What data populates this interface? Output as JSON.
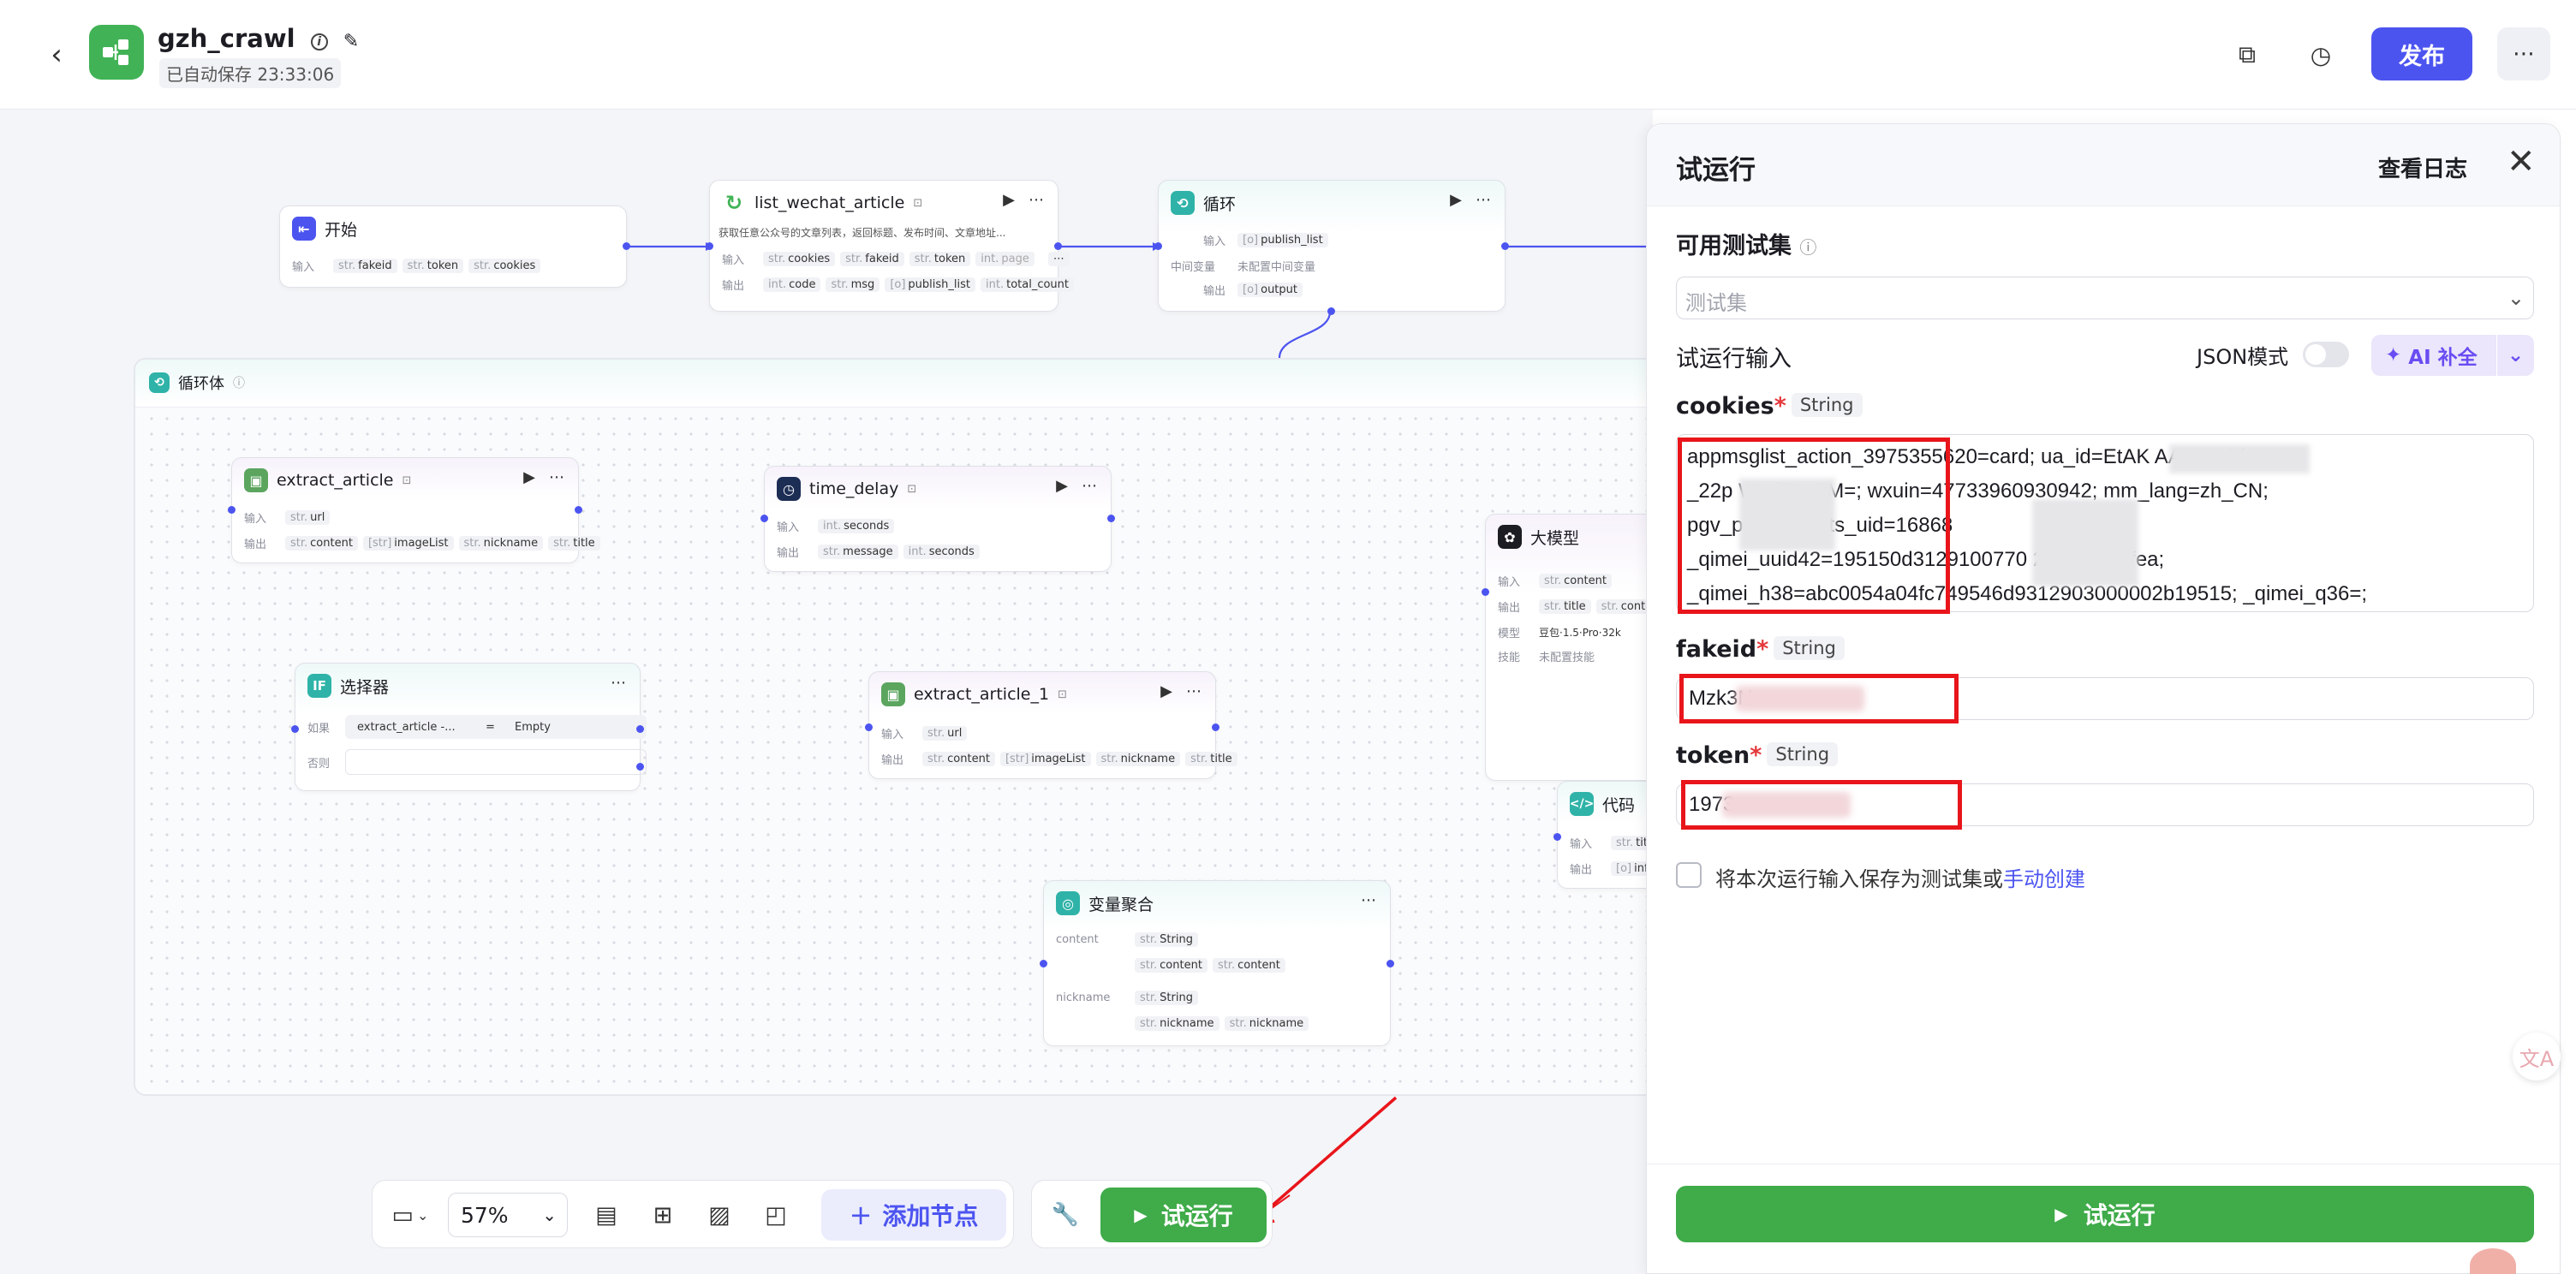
{
  "app": {
    "title": "gzh_crawl",
    "saved_status": "已自动保存 23:33:06",
    "publish_label": "发布"
  },
  "nodes": {
    "start": {
      "title": "开始",
      "input_label": "输入",
      "inputs": [
        "fakeid",
        "token",
        "cookies"
      ]
    },
    "list_wechat": {
      "title": "list_wechat_article",
      "desc": "获取任意公众号的文章列表，返回标题、发布时间、文章地址...",
      "input_label": "输入",
      "inputs": [
        "cookies",
        "fakeid",
        "token",
        "page"
      ],
      "output_label": "输出",
      "outputs": [
        "code",
        "msg",
        "publish_list",
        "total_count"
      ]
    },
    "loop": {
      "title": "循环",
      "input_label": "输入",
      "input_value": "publish_list",
      "var_label": "中间变量",
      "var_value": "未配置中间变量",
      "output_label": "输出",
      "output_value": "output"
    },
    "loop_body": {
      "title": "循环体"
    },
    "extract_article": {
      "title": "extract_article",
      "input_label": "输入",
      "inputs": [
        "url"
      ],
      "output_label": "输出",
      "outputs": [
        "content",
        "imageList",
        "nickname",
        "title"
      ]
    },
    "time_delay": {
      "title": "time_delay",
      "input_label": "输入",
      "inputs": [
        "seconds"
      ],
      "output_label": "输出",
      "outputs": [
        "message",
        "seconds"
      ]
    },
    "selector": {
      "title": "选择器",
      "if_label": "如果",
      "cond_left": "extract_article -...",
      "cond_op": "=",
      "cond_right": "Empty",
      "else_label": "否则"
    },
    "extract_article_1": {
      "title": "extract_article_1",
      "input_label": "输入",
      "inputs": [
        "url"
      ],
      "output_label": "输出",
      "outputs": [
        "content",
        "imageList",
        "nickname",
        "title"
      ]
    },
    "llm": {
      "title": "大模型",
      "input_label": "输入",
      "inputs": [
        "content"
      ],
      "output_label": "输出",
      "outputs": [
        "title",
        "content"
      ],
      "model_label": "模型",
      "model": "豆包·1.5·Pro·32k",
      "skill_label": "技能",
      "skill": "未配置技能"
    },
    "agg": {
      "title": "变量聚合",
      "g1": "content",
      "g1_type": "String",
      "g1_items": [
        "content",
        "content"
      ],
      "g2": "nickname",
      "g2_type": "String",
      "g2_items": [
        "nickname",
        "nickname"
      ]
    },
    "code": {
      "title": "代码",
      "input_label": "输入",
      "inputs": [
        "title"
      ],
      "output_label": "输出",
      "outputs": [
        "info"
      ]
    }
  },
  "toolbar": {
    "zoom": "57%",
    "add_node": "添加节点",
    "run": "试运行"
  },
  "panel": {
    "title": "试运行",
    "view_log": "查看日志",
    "testset_label": "可用测试集",
    "testset_placeholder": "测试集",
    "input_label": "试运行输入",
    "json_mode": "JSON模式",
    "ai_fill": "AI 补全",
    "cookies_label": "cookies",
    "cookies_type": "String",
    "cookies_lines": [
      "appmsglist_action_3975355620=card; ua_id=EtAK          AAAAAGf–",
      "_22p          WadE–z0M=; wxuin=47733960930942; mm_lang=zh_CN;",
      "pgv_p         831696; ts_uid=16868",
      "_qimei_uuid42=195150d3129100770          29f1846d6fea;",
      "_qimei_h38=abc0054a04fc749546d9312903000002b19515; _qimei_q36=;"
    ],
    "fakeid_label": "fakeid",
    "fakeid_type": "String",
    "fakeid_value": "Mzk3N",
    "token_label": "token",
    "token_type": "String",
    "token_value": "1973",
    "save_text": "将本次运行输入保存为测试集或",
    "save_link": "手动创建",
    "run_label": "试运行"
  },
  "colors": {
    "accent": "#4c54f0",
    "run_green": "#3fab49",
    "highlight_red": "#e8151b"
  }
}
